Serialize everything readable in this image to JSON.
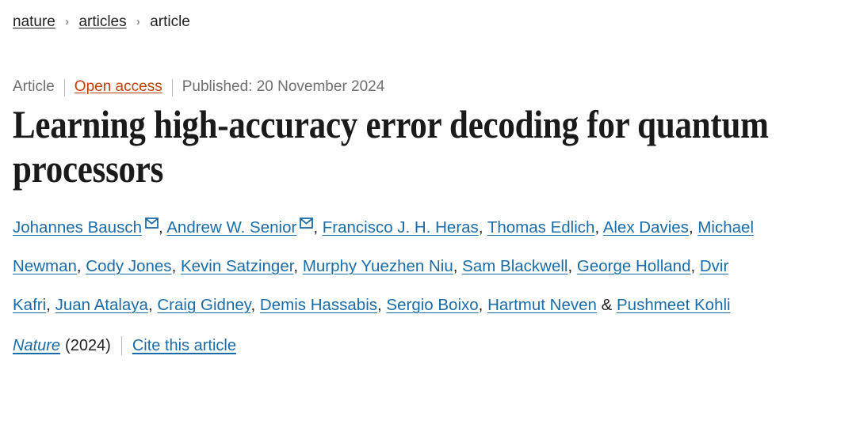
{
  "breadcrumb": {
    "separator": "›",
    "items": [
      {
        "label": "nature",
        "is_link": true
      },
      {
        "label": "articles",
        "is_link": true
      },
      {
        "label": "article",
        "is_link": false
      }
    ]
  },
  "meta": {
    "type_label": "Article",
    "access_label": "Open access",
    "published_label": "Published: 20 November 2024",
    "access_color": "#c0400b"
  },
  "title": "Learning high-accuracy error decoding for quantum processors",
  "authors": {
    "link_color": "#1a6ca8",
    "corresponding_icon": "envelope-icon",
    "list": [
      {
        "name": "Johannes Bausch",
        "corresponding": true
      },
      {
        "name": "Andrew W. Senior",
        "corresponding": true
      },
      {
        "name": "Francisco J. H. Heras",
        "corresponding": false
      },
      {
        "name": "Thomas Edlich",
        "corresponding": false
      },
      {
        "name": "Alex Davies",
        "corresponding": false
      },
      {
        "name": "Michael Newman",
        "corresponding": false
      },
      {
        "name": "Cody Jones",
        "corresponding": false
      },
      {
        "name": "Kevin Satzinger",
        "corresponding": false
      },
      {
        "name": "Murphy Yuezhen Niu",
        "corresponding": false
      },
      {
        "name": "Sam Blackwell",
        "corresponding": false
      },
      {
        "name": "George Holland",
        "corresponding": false
      },
      {
        "name": "Dvir Kafri",
        "corresponding": false
      },
      {
        "name": "Juan Atalaya",
        "corresponding": false
      },
      {
        "name": "Craig Gidney",
        "corresponding": false
      },
      {
        "name": "Demis Hassabis",
        "corresponding": false
      },
      {
        "name": "Sergio Boixo",
        "corresponding": false
      },
      {
        "name": "Hartmut Neven",
        "corresponding": false
      },
      {
        "name": "Pushmeet Kohli",
        "corresponding": false
      }
    ],
    "separator": ", ",
    "final_separator": " & "
  },
  "citation": {
    "journal": "Nature",
    "year": "(2024)",
    "cite_label": "Cite this article"
  }
}
